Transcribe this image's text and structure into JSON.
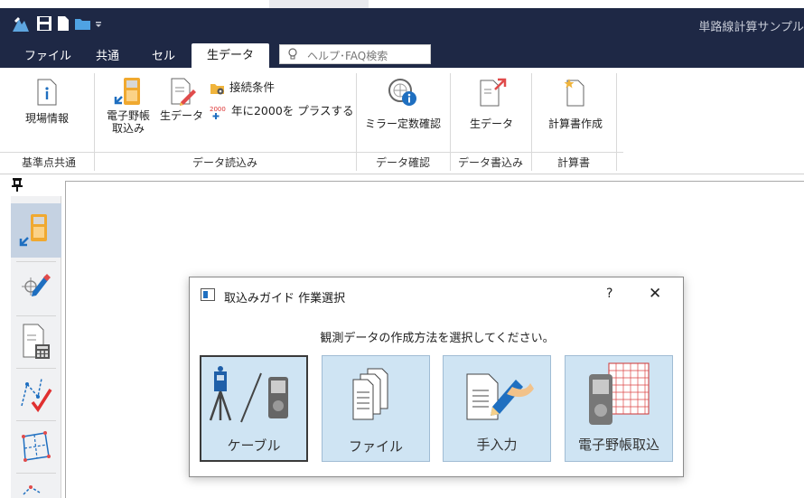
{
  "window": {
    "title": "単路線計算サンプル"
  },
  "menubar": {
    "items": [
      "ファイル",
      "共通",
      "セル"
    ],
    "active_tab": "生データ",
    "help_placeholder": "ヘルプ･FAQ検索"
  },
  "ribbon": {
    "groups": {
      "base": "基準点共通",
      "read": "データ読込み",
      "check": "データ確認",
      "write": "データ書込み",
      "report": "計算書"
    },
    "buttons": {
      "site_info": "現場情報",
      "field_book_import_l1": "電子野帳",
      "field_book_import_l2": "取込み",
      "raw_data": "生データ",
      "connection": "接続条件",
      "add2000": "年に2000を プラスする",
      "mirror_check": "ミラー定数確認",
      "raw_data_write": "生データ",
      "create_report": "計算書作成"
    }
  },
  "dialog": {
    "title": "取込みガイド 作業選択",
    "help": "?",
    "close": "✕",
    "message": "観測データの作成方法を選択してください。",
    "options": [
      "ケーブル",
      "ファイル",
      "手入力",
      "電子野帳取込"
    ]
  },
  "colors": {
    "titlebar": "#1e2845",
    "option_bg": "#cfe4f3",
    "sidebar_active": "#c5d2e2"
  }
}
